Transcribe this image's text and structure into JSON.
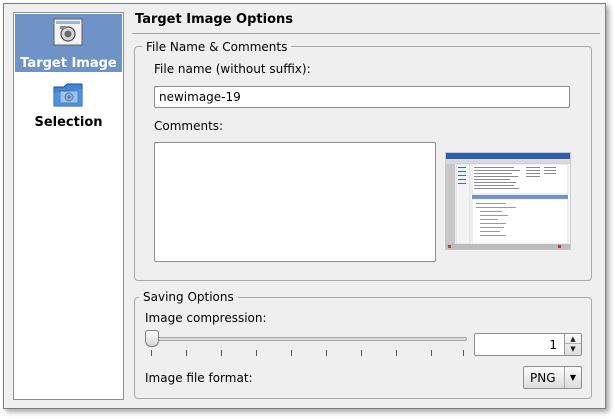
{
  "sidebar": {
    "items": [
      {
        "label": "Target Image",
        "icon": "image-document-icon",
        "active": true
      },
      {
        "label": "Selection",
        "icon": "selection-folder-icon",
        "active": false
      }
    ]
  },
  "page": {
    "title": "Target Image Options"
  },
  "file_group": {
    "title": "File Name & Comments",
    "filename_label": "File name (without suffix):",
    "filename_value": "newimage-19",
    "comments_label": "Comments:",
    "comments_value": ""
  },
  "saving_group": {
    "title": "Saving Options",
    "compression_label": "Image compression:",
    "compression_value": "1",
    "compression_slider_level": 0,
    "format_label": "Image file format:",
    "format_value": "PNG"
  },
  "colors": {
    "accent": "#6f93c6",
    "window_bg": "#efefef"
  }
}
